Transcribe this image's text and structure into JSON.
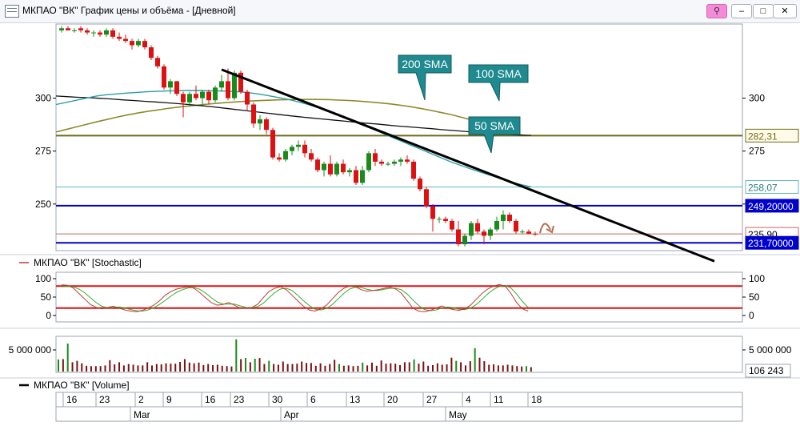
{
  "window": {
    "title": "МКПАО \"ВК\" График цены и объёма - [Дневной]",
    "buttons": {
      "pin": "⚲",
      "minimize": "–",
      "maximize": "□",
      "close": "✕"
    }
  },
  "colors": {
    "bull": "#1a8a1a",
    "bear": "#dd1111",
    "sma50": "#2a9fa8",
    "sma100": "#8f8a2a",
    "sma200": "#111111",
    "trendline": "#000000",
    "level_blue": "#0000cc",
    "callout": "#1f8a8f",
    "stoch_k": "#c03a3a",
    "stoch_d": "#2db02d",
    "stoch_band": "#dd1111",
    "vol_up": "#1a8a1a",
    "vol_down": "#7a1010"
  },
  "chart_data": {
    "type": "candlestick",
    "price_axis": {
      "ticks": [
        250,
        275,
        300
      ],
      "labels": [
        "250",
        "275",
        "300"
      ],
      "range": [
        228,
        335
      ]
    },
    "x_axis": {
      "day_ticks": [
        "16",
        "23",
        "2",
        "9",
        "16",
        "23",
        "30",
        "6",
        "13",
        "20",
        "27",
        "4",
        "11",
        "18"
      ],
      "months": [
        "Mar",
        "Apr",
        "May"
      ]
    },
    "candles": [
      {
        "o": 332,
        "h": 334,
        "l": 331,
        "c": 333
      },
      {
        "o": 333,
        "h": 334,
        "l": 332,
        "c": 332
      },
      {
        "o": 332,
        "h": 333,
        "l": 331,
        "c": 332
      },
      {
        "o": 333,
        "h": 334,
        "l": 331,
        "c": 332
      },
      {
        "o": 332,
        "h": 333,
        "l": 330,
        "c": 331
      },
      {
        "o": 331,
        "h": 332,
        "l": 329,
        "c": 331
      },
      {
        "o": 331,
        "h": 332,
        "l": 329,
        "c": 330
      },
      {
        "o": 330,
        "h": 333,
        "l": 329,
        "c": 332
      },
      {
        "o": 332,
        "h": 333,
        "l": 328,
        "c": 329
      },
      {
        "o": 329,
        "h": 331,
        "l": 327,
        "c": 328
      },
      {
        "o": 328,
        "h": 330,
        "l": 326,
        "c": 327
      },
      {
        "o": 327,
        "h": 328,
        "l": 323,
        "c": 325
      },
      {
        "o": 325,
        "h": 328,
        "l": 324,
        "c": 327
      },
      {
        "o": 327,
        "h": 328,
        "l": 323,
        "c": 324
      },
      {
        "o": 324,
        "h": 325,
        "l": 318,
        "c": 319
      },
      {
        "o": 319,
        "h": 320,
        "l": 314,
        "c": 315
      },
      {
        "o": 315,
        "h": 316,
        "l": 304,
        "c": 305
      },
      {
        "o": 305,
        "h": 309,
        "l": 302,
        "c": 308
      },
      {
        "o": 308,
        "h": 308,
        "l": 301,
        "c": 302
      },
      {
        "o": 302,
        "h": 303,
        "l": 291,
        "c": 298
      },
      {
        "o": 298,
        "h": 303,
        "l": 296,
        "c": 302
      },
      {
        "o": 302,
        "h": 306,
        "l": 299,
        "c": 300
      },
      {
        "o": 300,
        "h": 304,
        "l": 297,
        "c": 303
      },
      {
        "o": 303,
        "h": 304,
        "l": 297,
        "c": 299
      },
      {
        "o": 299,
        "h": 306,
        "l": 298,
        "c": 305
      },
      {
        "o": 305,
        "h": 311,
        "l": 303,
        "c": 308
      },
      {
        "o": 308,
        "h": 314,
        "l": 299,
        "c": 300
      },
      {
        "o": 300,
        "h": 313,
        "l": 299,
        "c": 312
      },
      {
        "o": 312,
        "h": 313,
        "l": 302,
        "c": 303
      },
      {
        "o": 303,
        "h": 304,
        "l": 294,
        "c": 297
      },
      {
        "o": 297,
        "h": 298,
        "l": 286,
        "c": 288
      },
      {
        "o": 288,
        "h": 292,
        "l": 285,
        "c": 290
      },
      {
        "o": 290,
        "h": 291,
        "l": 283,
        "c": 285
      },
      {
        "o": 285,
        "h": 286,
        "l": 271,
        "c": 272
      },
      {
        "o": 272,
        "h": 274,
        "l": 270,
        "c": 271
      },
      {
        "o": 271,
        "h": 276,
        "l": 270,
        "c": 275
      },
      {
        "o": 275,
        "h": 278,
        "l": 273,
        "c": 277
      },
      {
        "o": 277,
        "h": 280,
        "l": 275,
        "c": 278
      },
      {
        "o": 278,
        "h": 280,
        "l": 272,
        "c": 274
      },
      {
        "o": 274,
        "h": 276,
        "l": 270,
        "c": 271
      },
      {
        "o": 271,
        "h": 272,
        "l": 265,
        "c": 266
      },
      {
        "o": 266,
        "h": 270,
        "l": 263,
        "c": 269
      },
      {
        "o": 269,
        "h": 273,
        "l": 263,
        "c": 264
      },
      {
        "o": 264,
        "h": 270,
        "l": 263,
        "c": 269
      },
      {
        "o": 269,
        "h": 271,
        "l": 264,
        "c": 265
      },
      {
        "o": 265,
        "h": 267,
        "l": 263,
        "c": 266
      },
      {
        "o": 266,
        "h": 268,
        "l": 259,
        "c": 260
      },
      {
        "o": 260,
        "h": 268,
        "l": 259,
        "c": 266
      },
      {
        "o": 266,
        "h": 275,
        "l": 265,
        "c": 274
      },
      {
        "o": 274,
        "h": 276,
        "l": 268,
        "c": 270
      },
      {
        "o": 270,
        "h": 271,
        "l": 268,
        "c": 269
      },
      {
        "o": 269,
        "h": 270,
        "l": 268,
        "c": 269
      },
      {
        "o": 269,
        "h": 271,
        "l": 268,
        "c": 270
      },
      {
        "o": 270,
        "h": 272,
        "l": 268,
        "c": 271
      },
      {
        "o": 271,
        "h": 273,
        "l": 269,
        "c": 270
      },
      {
        "o": 270,
        "h": 271,
        "l": 261,
        "c": 262
      },
      {
        "o": 262,
        "h": 263,
        "l": 256,
        "c": 257
      },
      {
        "o": 257,
        "h": 258,
        "l": 248,
        "c": 249
      },
      {
        "o": 249,
        "h": 250,
        "l": 237,
        "c": 243
      },
      {
        "o": 243,
        "h": 244,
        "l": 241,
        "c": 243
      },
      {
        "o": 243,
        "h": 244,
        "l": 241,
        "c": 242
      },
      {
        "o": 242,
        "h": 243,
        "l": 237,
        "c": 238
      },
      {
        "o": 238,
        "h": 242,
        "l": 230,
        "c": 231
      },
      {
        "o": 231,
        "h": 236,
        "l": 230,
        "c": 235
      },
      {
        "o": 235,
        "h": 242,
        "l": 233,
        "c": 241
      },
      {
        "o": 241,
        "h": 243,
        "l": 236,
        "c": 237
      },
      {
        "o": 237,
        "h": 238,
        "l": 231,
        "c": 235
      },
      {
        "o": 235,
        "h": 239,
        "l": 233,
        "c": 238
      },
      {
        "o": 238,
        "h": 244,
        "l": 237,
        "c": 242
      },
      {
        "o": 242,
        "h": 247,
        "l": 238,
        "c": 245
      },
      {
        "o": 245,
        "h": 246,
        "l": 241,
        "c": 242
      },
      {
        "o": 242,
        "h": 243,
        "l": 236,
        "c": 237
      },
      {
        "o": 237,
        "h": 238,
        "l": 236,
        "c": 237
      },
      {
        "o": 237,
        "h": 238,
        "l": 236,
        "c": 236
      },
      {
        "o": 236,
        "h": 237,
        "l": 235,
        "c": 235.9
      }
    ],
    "sma": {
      "sma50": [
        297,
        298,
        299,
        300,
        301,
        301.6,
        302,
        302.4,
        302.7,
        303,
        303.2,
        303.4,
        303.5,
        303.6,
        303.6,
        303.5,
        303.4,
        303.3,
        303,
        302.6,
        302,
        301.2,
        300.3,
        299.4,
        298.2,
        296.9,
        295.4,
        293.7,
        291.8,
        289.9,
        288,
        286,
        284,
        282,
        280,
        278,
        276,
        274,
        272,
        270,
        268.3,
        266.6,
        265,
        263.5,
        262,
        260.5,
        259.2,
        258.1
      ],
      "sma100": [
        284,
        285.2,
        286.4,
        287.6,
        288.8,
        289.9,
        291,
        292,
        292.9,
        293.7,
        294.4,
        295.1,
        295.7,
        296.2,
        296.7,
        297.2,
        297.6,
        298,
        298.3,
        298.6,
        298.8,
        299,
        299.2,
        299.3,
        299.4,
        299.4,
        299.4,
        299.3,
        299.1,
        298.9,
        298.6,
        298.2,
        297.8,
        297.3,
        296.7,
        296,
        295.2,
        294.3,
        293.3,
        292.3,
        291.1,
        289.8,
        288.4,
        286.9,
        285.3,
        283.7,
        282.6,
        282.31
      ],
      "sma200": [
        301,
        300.7,
        300.4,
        300.2,
        299.9,
        299.6,
        299.2,
        298.9,
        298.5,
        298.2,
        297.8,
        297.4,
        297,
        296.5,
        296,
        295.4,
        294.8,
        294.2,
        293.6,
        293,
        292.4,
        291.8,
        291.2,
        290.7,
        290.2,
        289.7,
        289.2,
        288.7,
        288.2,
        287.8,
        287.3,
        286.8,
        286.4,
        286,
        285.6,
        285.1,
        284.7,
        284.3,
        283.9,
        283.5,
        283.2,
        282.9,
        282.6,
        282.4
      ]
    },
    "levels": [
      {
        "label": "282,31",
        "value": 282.31,
        "kind": "sma100"
      },
      {
        "label": "258,07",
        "value": 258.07,
        "kind": "sma50"
      },
      {
        "label": "249,20000",
        "value": 249.2,
        "kind": "support"
      },
      {
        "label": "235,90",
        "value": 235.9,
        "kind": "last"
      },
      {
        "label": "231,70000",
        "value": 231.7,
        "kind": "support"
      }
    ],
    "trendline": {
      "from": {
        "candle": 25,
        "price": 313.5
      },
      "to": {
        "candle": 102,
        "price": 223
      }
    },
    "annotations": [
      "200 SMA",
      "100 SMA",
      "50 SMA"
    ],
    "stochastic": {
      "title": "МКПАО \"ВК\" [Stochastic]",
      "ticks": [
        0,
        50,
        100
      ],
      "bands": [
        80,
        20
      ],
      "k": [
        83,
        82,
        75,
        60,
        45,
        30,
        22,
        18,
        22,
        25,
        20,
        15,
        12,
        10,
        14,
        20,
        28,
        40,
        55,
        65,
        72,
        75,
        78,
        74,
        62,
        48,
        35,
        28,
        30,
        35,
        28,
        20,
        20,
        22,
        30,
        48,
        65,
        74,
        78,
        70,
        55,
        40,
        25,
        15,
        12,
        18,
        28,
        45,
        62,
        74,
        80,
        78,
        70,
        66,
        68,
        70,
        74,
        77,
        72,
        60,
        40,
        20,
        12,
        10,
        14,
        20,
        26,
        20,
        16,
        14,
        18,
        28,
        44,
        60,
        72,
        80,
        84,
        80,
        60,
        35,
        18,
        12
      ],
      "d": [
        78,
        79,
        78,
        72,
        62,
        48,
        35,
        25,
        21,
        22,
        23,
        20,
        16,
        13,
        12,
        15,
        21,
        30,
        41,
        53,
        63,
        70,
        75,
        76,
        71,
        61,
        48,
        37,
        31,
        31,
        31,
        26,
        22,
        21,
        24,
        33,
        48,
        62,
        72,
        74,
        68,
        55,
        40,
        27,
        17,
        15,
        19,
        30,
        45,
        60,
        72,
        77,
        76,
        71,
        68,
        68,
        71,
        74,
        74,
        70,
        58,
        42,
        27,
        16,
        13,
        15,
        20,
        23,
        21,
        17,
        16,
        20,
        30,
        44,
        59,
        71,
        79,
        82,
        75,
        58,
        38,
        22
      ]
    },
    "volume": {
      "title": "МКПАО \"ВК\" [Volume]",
      "tick_label": "5 000 000",
      "tick_value": 5000000,
      "last_label": "106 243",
      "values": [
        2.3,
        2.4,
        6.8,
        1.5,
        1.9,
        1.2,
        0.5,
        0.4,
        0.4,
        0.4,
        0.6,
        2.1,
        0.9,
        1.5,
        0.6,
        1.0,
        0.8,
        0.6,
        0.6,
        1.5,
        0.6,
        1.0,
        0.9,
        1.2,
        1.1,
        1.1,
        1.6,
        2.4,
        1.4,
        1.2,
        1.4,
        0.7,
        1.0,
        0.7,
        0.8,
        0.5,
        0.4,
        0.3,
        8.0,
        2.4,
        2.7,
        1.5,
        2.5,
        2.7,
        1.0,
        1.9,
        1.0,
        0.8,
        1.7,
        1.0,
        1.0,
        1.1,
        1.7,
        1.3,
        1.3,
        0.5,
        1.2,
        0.5,
        1.0,
        2.2,
        1.0,
        0.5,
        0.6,
        0.4,
        0.5,
        1.4,
        0.6,
        1.4,
        0.5,
        2.0,
        1.1,
        1.2,
        1.1,
        0.7,
        1.5,
        1.5,
        2.3,
        1.1,
        1.7,
        0.5,
        0.7,
        1.2,
        0.8,
        0.9,
        2.8,
        1.9,
        1.5,
        0.6,
        1.8,
        5.5,
        2.8,
        1.8,
        0.8,
        0.9,
        0.6,
        0.6,
        0.8,
        0.6,
        0.4,
        0.3,
        0.4,
        0.1
      ],
      "up_flags": [
        1,
        0,
        1,
        0,
        0,
        0,
        0,
        0,
        0,
        0,
        0,
        0,
        0,
        0,
        0,
        0,
        0,
        0,
        0,
        0,
        0,
        0,
        0,
        0,
        0,
        0,
        0,
        0,
        0,
        0,
        0,
        0,
        0,
        0,
        0,
        0,
        0,
        0,
        1,
        0,
        1,
        0,
        1,
        0,
        0,
        1,
        0,
        0,
        0,
        0,
        0,
        0,
        0,
        0,
        0,
        0,
        0,
        0,
        0,
        0,
        1,
        0,
        0,
        0,
        0,
        1,
        0,
        0,
        0,
        0,
        0,
        0,
        0,
        0,
        0,
        0,
        1,
        0,
        0,
        0,
        0,
        0,
        0,
        0,
        0,
        1,
        0,
        0,
        0,
        1,
        0,
        0,
        0,
        0,
        0,
        0,
        0,
        0,
        0,
        0,
        1,
        0
      ]
    }
  }
}
